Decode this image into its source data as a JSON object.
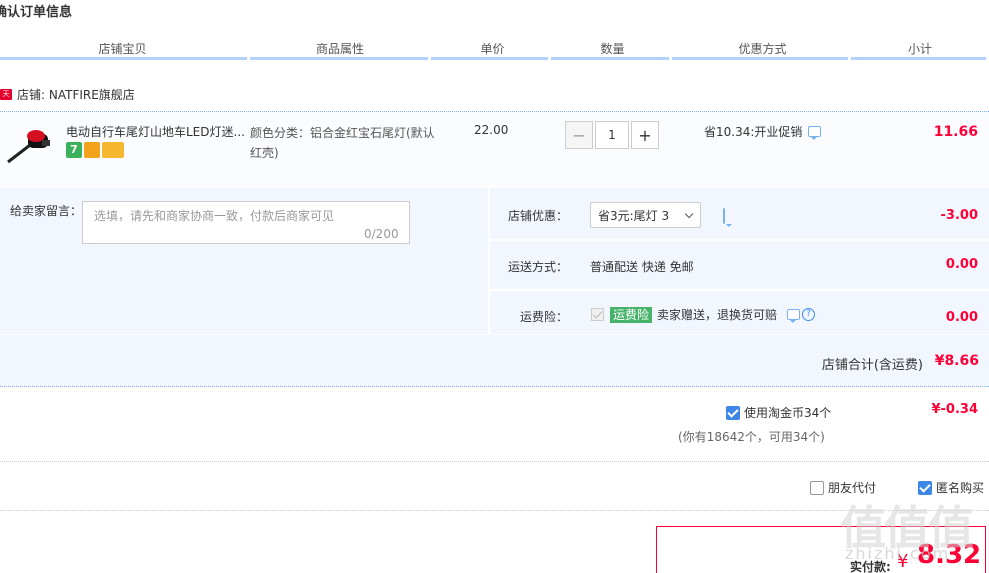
{
  "page_title": "确认订单信息",
  "columns": [
    "店铺宝贝",
    "商品属性",
    "单价",
    "数量",
    "优惠方式",
    "小计"
  ],
  "shop": {
    "badge": "天猫",
    "name": "店铺: NATFIRE旗舰店"
  },
  "item": {
    "title": "电动自行车尾灯山地车LED灯迷...",
    "sku": "颜色分类：铝合金红宝石尾灯(默认红壳)",
    "price": "22.00",
    "quantity": "1",
    "minus": "−",
    "plus": "+",
    "promo": "省10.34:开业促销",
    "subtotal": "11.66"
  },
  "memo": {
    "label": "给卖家留言：",
    "placeholder": "选填，请先和商家协商一致，付款后商家可见",
    "count": "0/200"
  },
  "discount": {
    "label": "店铺优惠：",
    "selected": "省3元:尾灯 3",
    "value": "-3.00"
  },
  "shipping": {
    "label": "运送方式：",
    "method": "普通配送 快递 免邮",
    "value": "0.00"
  },
  "insurance": {
    "label": "运费险：",
    "badge": "运费险",
    "text": "卖家赠送，退换货可赔",
    "help": "?",
    "value": "0.00"
  },
  "shop_total": {
    "label": "店铺合计(含运费)",
    "value": "¥8.66"
  },
  "coins": {
    "label": "使用淘金币34个",
    "note": "(你有18642个，可用34个)",
    "value": "¥-0.34"
  },
  "options": {
    "friend_pay": "朋友代付",
    "anonymous": "匿名购买"
  },
  "payment": {
    "label": "实付款:",
    "currency": "¥",
    "value": "8.32"
  },
  "watermark": {
    "main": "值值值",
    "sub": "zhizhi.com"
  },
  "colors": {
    "price_red": "#ff0036",
    "accent_blue": "#3d85e6",
    "panel_bg": "#f2f7ff"
  }
}
